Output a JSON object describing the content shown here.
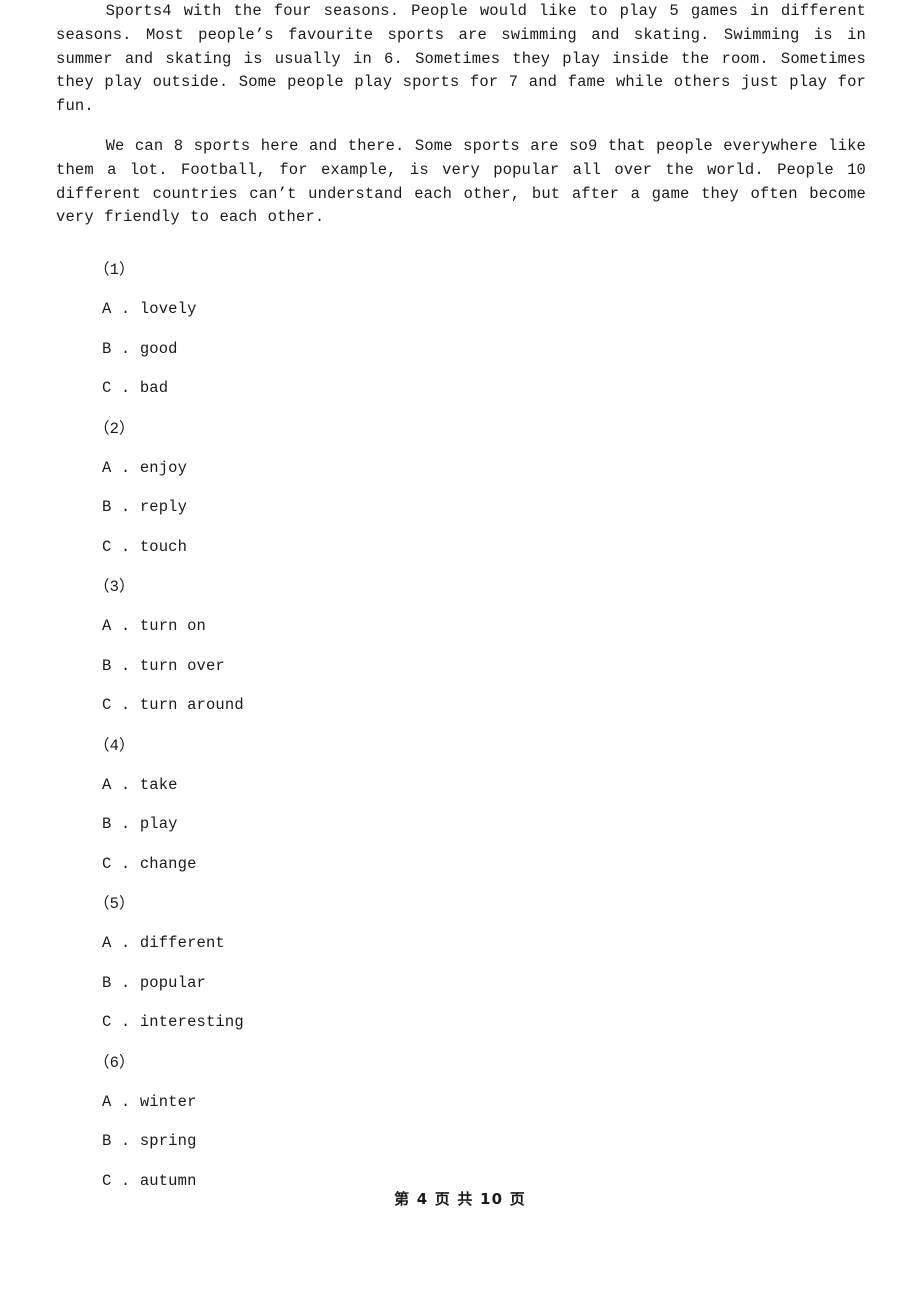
{
  "document": {
    "type": "cloze-test-worksheet",
    "passage": {
      "paragraphs": [
        "Sports4 with the four seasons. People would like to play 5 games in different seasons. Most people’s favourite sports are swimming and skating. Swimming is in summer and skating is usually in 6. Sometimes they play inside the room. Sometimes they play outside. Some people play sports for 7 and fame while others just play for fun.",
        "We can 8 sports here and there. Some sports are so9 that people everywhere like them a lot. Football, for example, is very popular all over the world. People 10 different countries can’t understand each other, but after a game they often become very friendly to each other."
      ]
    },
    "questions": [
      {
        "number": "（1）",
        "options": [
          {
            "letter": "A",
            "separator": ".",
            "text": "lovely"
          },
          {
            "letter": "B",
            "separator": ".",
            "text": "good"
          },
          {
            "letter": "C",
            "separator": ".",
            "text": "bad"
          }
        ]
      },
      {
        "number": "（2）",
        "options": [
          {
            "letter": "A",
            "separator": ".",
            "text": "enjoy"
          },
          {
            "letter": "B",
            "separator": ".",
            "text": "reply"
          },
          {
            "letter": "C",
            "separator": ".",
            "text": "touch"
          }
        ]
      },
      {
        "number": "（3）",
        "options": [
          {
            "letter": "A",
            "separator": ".",
            "text": "turn on"
          },
          {
            "letter": "B",
            "separator": ".",
            "text": "turn over"
          },
          {
            "letter": "C",
            "separator": ".",
            "text": "turn around"
          }
        ]
      },
      {
        "number": "（4）",
        "options": [
          {
            "letter": "A",
            "separator": ".",
            "text": "take"
          },
          {
            "letter": "B",
            "separator": ".",
            "text": "play"
          },
          {
            "letter": "C",
            "separator": ".",
            "text": "change"
          }
        ]
      },
      {
        "number": "（5）",
        "options": [
          {
            "letter": "A",
            "separator": ".",
            "text": "different"
          },
          {
            "letter": "B",
            "separator": ".",
            "text": "popular"
          },
          {
            "letter": "C",
            "separator": ".",
            "text": "interesting"
          }
        ]
      },
      {
        "number": "（6）",
        "options": [
          {
            "letter": "A",
            "separator": ".",
            "text": "winter"
          },
          {
            "letter": "B",
            "separator": ".",
            "text": "spring"
          },
          {
            "letter": "C",
            "separator": ".",
            "text": "autumn"
          }
        ]
      }
    ],
    "footer": {
      "text": "第 4 页 共 10 页",
      "current_page": "4",
      "total_pages": "10"
    },
    "colors": {
      "background": "#ffffff",
      "text": "#1a1a1a"
    }
  }
}
